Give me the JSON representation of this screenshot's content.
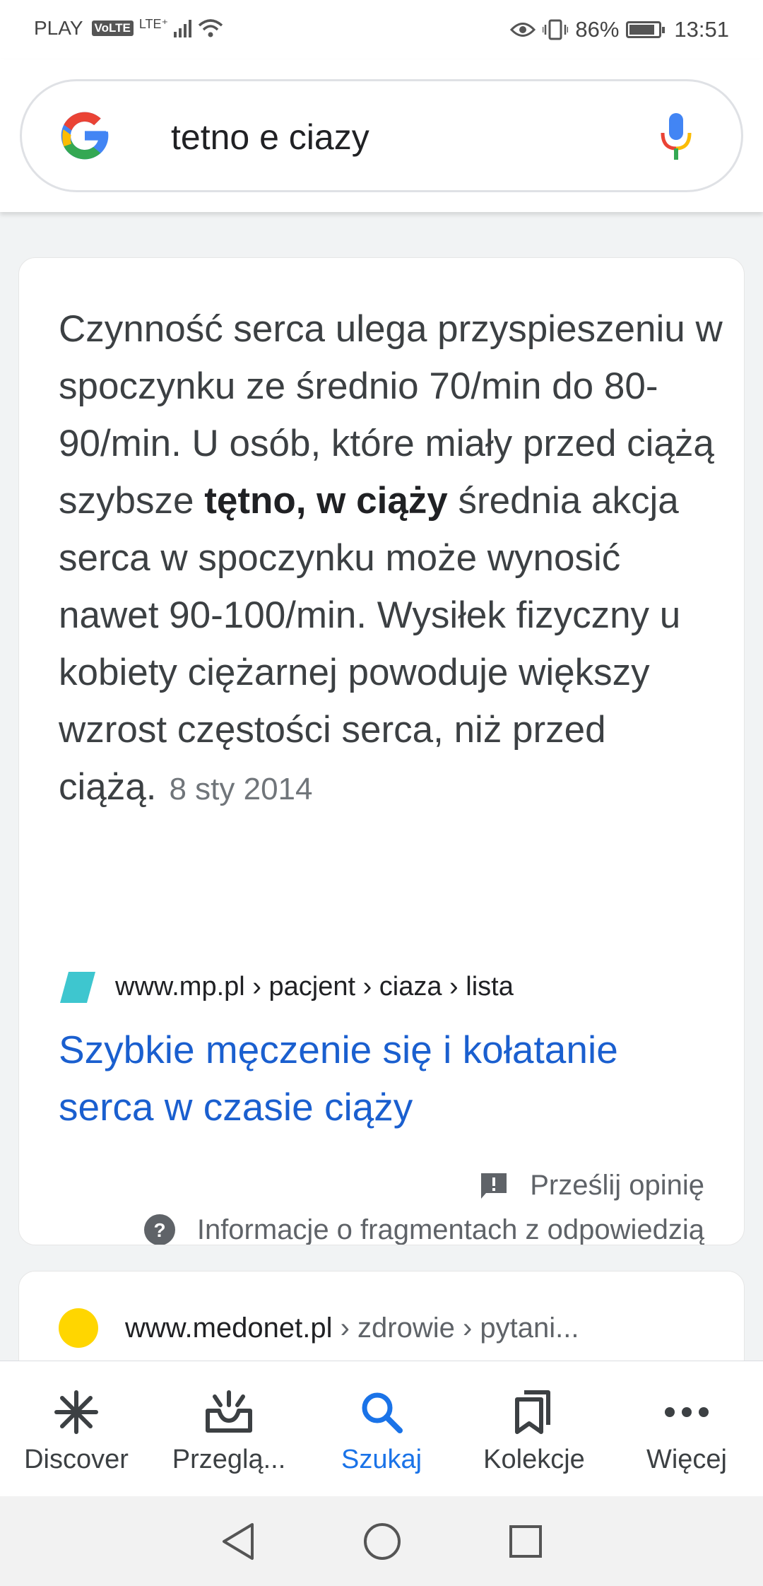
{
  "status_bar": {
    "carrier": "PLAY",
    "volte": "VoLTE",
    "network": "LTE⁺",
    "battery": "86%",
    "battery_level": 0.86,
    "time": "13:51"
  },
  "search": {
    "query": "tetno e ciazy"
  },
  "featured_snippet": {
    "text_before": "Czynność serca ulega przyspieszeniu w spoczynku ze średnio 70/min do 80-90/min. U osób, które miały przed ciążą szybsze ",
    "text_bold": "tętno, w ciąży",
    "text_after": " średnia akcja serca w spoczynku może wynosić nawet 90-100/min. Wysiłek fizyczny u kobiety ciężarnej powoduje większy wzrost częstości serca, niż przed ciążą.",
    "date": "8 sty 2014",
    "source_url": "www.mp.pl › pacjent › ciaza › lista",
    "title": "Szybkie męczenie się i kołatanie serca w czasie ciąży",
    "feedback_label": "Prześlij opinię",
    "info_label": "Informacje o fragmentach z odpowiedzią"
  },
  "next_result": {
    "domain": "www.medonet.pl",
    "path": " › zdrowie › pytani..."
  },
  "bottom_nav": [
    {
      "label": "Discover",
      "icon": "asterisk-icon"
    },
    {
      "label": "Przeglą...",
      "icon": "inbox-icon"
    },
    {
      "label": "Szukaj",
      "icon": "search-icon"
    },
    {
      "label": "Kolekcje",
      "icon": "bookmarks-icon"
    },
    {
      "label": "Więcej",
      "icon": "more-icon"
    }
  ],
  "colors": {
    "accent": "#1a73e8",
    "link": "#1a5fcf",
    "source_icon": "#3ec6cf",
    "medonet_dot": "#ffd600"
  }
}
